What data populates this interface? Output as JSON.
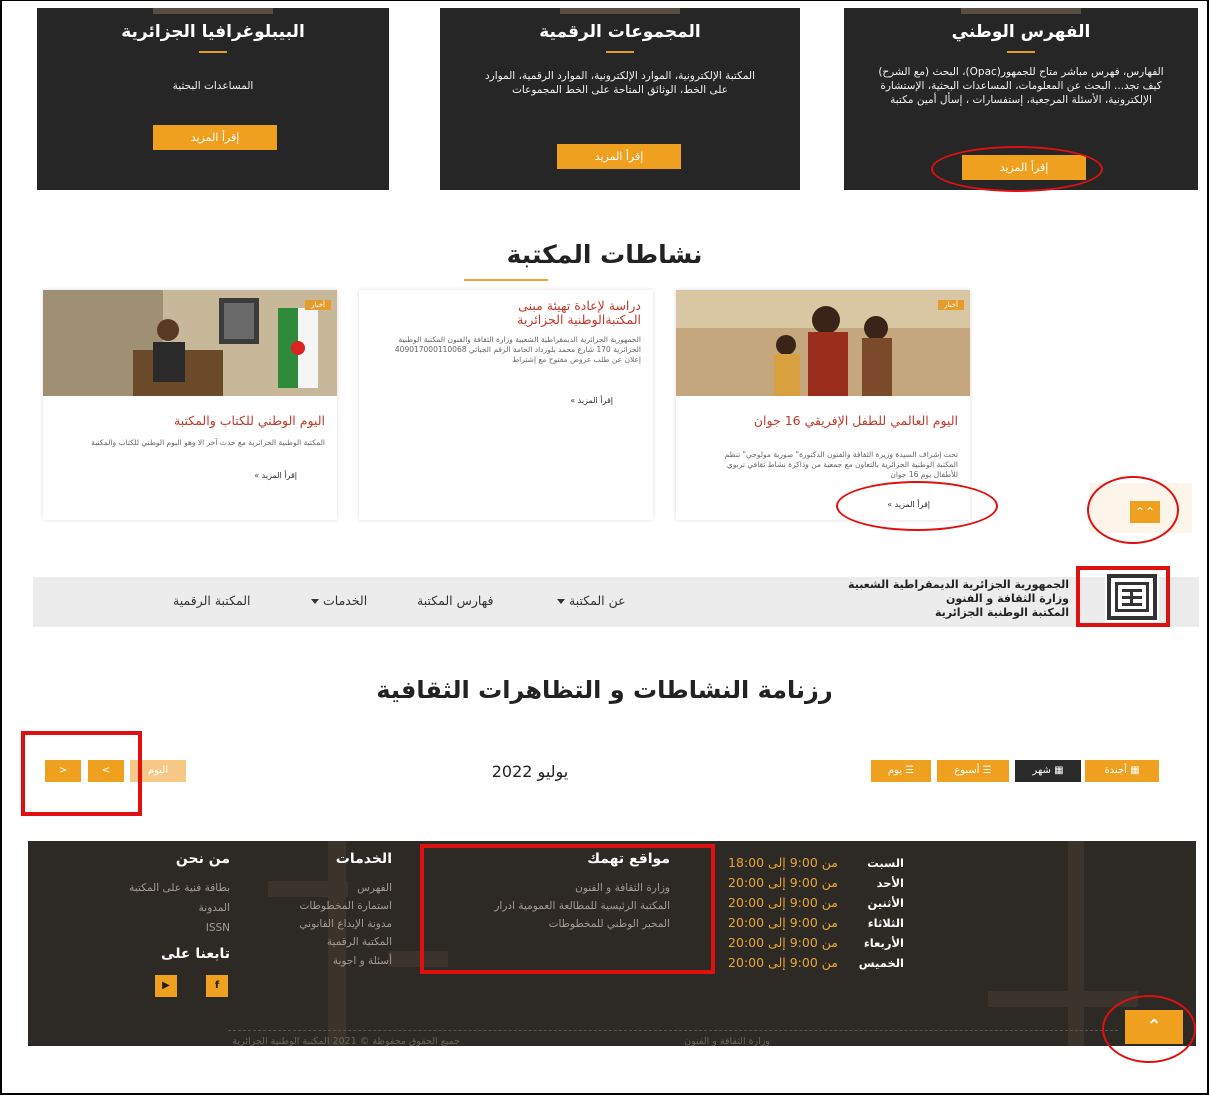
{
  "top_cards": [
    {
      "title": "البيبلوغرافيا الجزائرية",
      "text": "المساعدات البحثية",
      "button": "إقرأ المزيد"
    },
    {
      "title": "المجموعات الرقمية",
      "text": "المكتبة الإلكترونية، الموارد الإلكترونية، الموارد الرقمية، الموارد على الخط، الوثائق المتاحة على الخط المجموعات",
      "button": "إقرأ المزيد"
    },
    {
      "title": "الفهرس الوطني",
      "text": "الفهارس، فهرس مباشر متاح للجمهور(Opac)، البحث (مع الشرح) كيف تجد... البحث عن المعلومات، المساعدات البحثية، الإستشارة الإلكترونية، الأسئلة المرجعية، إستفسارات ، إسأل أمين مكتبة",
      "button": "إقرأ المزيد"
    }
  ],
  "activities": {
    "title": "نشاطات المكتبة",
    "cards": [
      {
        "tag": "أخبار",
        "title": "اليوم الوطني للكتاب والمكتبة",
        "text": "المكتبة الوطنية الجزائرية مع حدث آخر الا وهو اليوم الوطني للكتاب والمكتبة",
        "more": "إقرأ المزيد »"
      },
      {
        "tag": "",
        "title": "دراسة لإعادة تهيئة مبنى المكتبةالوطنية الجزائرية",
        "text": "الجمهورية الجزائرية الديمقراطية الشعبية وزارة الثقافة والفنون المكتبة الوطنية الجزائرية 170 شارع محمد بلوزداد الحامة الرقم الجبائي 409017000110068 إعلان عن طلب عروض مفتوح مع إشتراط",
        "more": "إقرأ المزيد »"
      },
      {
        "tag": "أخبار",
        "title": "اليوم العالمي للطفل الإفريقي 16 جوان",
        "text": "تحت إشراف السيدة وزيرة الثقافة والفنون الدكتورة\" صورية مولوجي\" تنظم المكتبة الوطنية الجزائرية بالتعاون مع جمعية من وذاكرة نشاط ثقافي تربوي للأطفال يوم 16 جوان",
        "more": "إقرأ المزيد »"
      }
    ]
  },
  "navbar": {
    "org_lines": [
      "الجمهورية الجزائرية الديمقراطية الشعبية",
      "وزارة الثقافة و الفنون",
      "المكتبة الوطنية الجزائرية"
    ],
    "items": [
      "عن المكتبة",
      "فهارس المكتبة",
      "الخدمات",
      "المكتبة الرقمية"
    ]
  },
  "calendar": {
    "title": "رزنامة النشاطات و التظاهرات الثقافية",
    "month": "يوليو 2022",
    "today": "اليوم",
    "prev": "<",
    "next": ">",
    "views": [
      "أجندة",
      "شهر",
      "أسبوع",
      "يوم"
    ]
  },
  "footer": {
    "about": {
      "title": "من نحن",
      "links": [
        "بطاقة فنية على المكتبة",
        "المدونة",
        "ISSN"
      ]
    },
    "follow": {
      "title": "تابعنا على",
      "icons": [
        "youtube-icon",
        "facebook-icon"
      ]
    },
    "services": {
      "title": "الخدمات",
      "links": [
        "الفهرس",
        "استمارة المخطوطات",
        "مدونة الإيداع القانوني",
        "المكتبة الرقمية",
        "أسئلة و اجوبة"
      ]
    },
    "sites": {
      "title": "مواقع تهمك",
      "links": [
        "وزارة الثقافة و الفنون",
        "المكتبة الرئيسية للمطالعة العمومية ادرار",
        "المحبر الوطني للمخطوطات"
      ]
    },
    "hours": [
      {
        "day": "السبت",
        "time": "من 9:00 إلى 18:00"
      },
      {
        "day": "الأحد",
        "time": "من 9:00 إلى 20:00"
      },
      {
        "day": "الأثنين",
        "time": "من 9:00 إلى 20:00"
      },
      {
        "day": "الثلاثاء",
        "time": "من 9:00 إلى 20:00"
      },
      {
        "day": "الأربعاء",
        "time": "من 9:00 إلى 20:00"
      },
      {
        "day": "الخميس",
        "time": "من 9:00 إلى 20:00"
      }
    ],
    "copyright": "جميع الحقوق محفوظة © 2021 المكتبة الوطنية الجزائرية",
    "ministry": "وزارة الثقافة و الفنون"
  },
  "colors": {
    "accent": "#f0a01f",
    "dark": "#262626",
    "red": "#c0392b",
    "annotation": "#e01010"
  }
}
